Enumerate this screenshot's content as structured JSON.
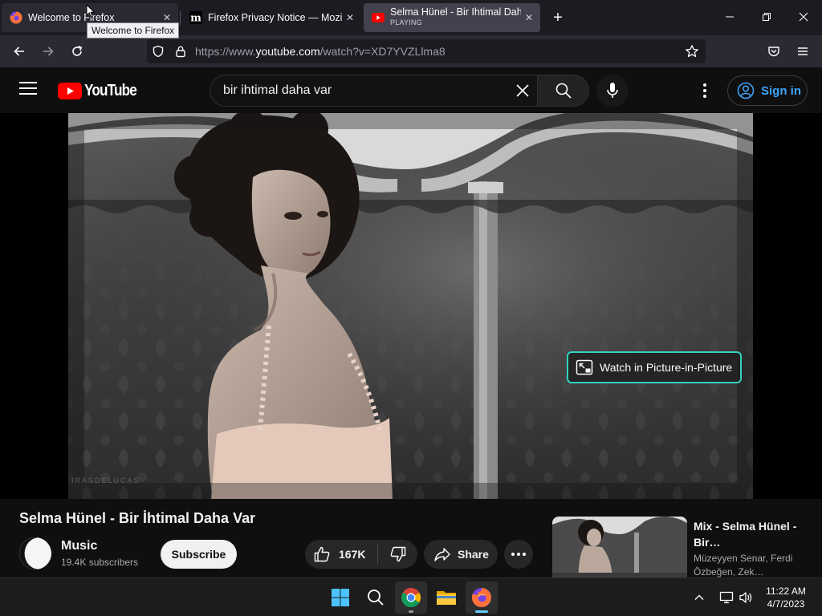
{
  "browser": {
    "tabs": [
      {
        "label": "Welcome to Firefox",
        "icon": "firefox-icon"
      },
      {
        "label": "Firefox Privacy Notice — Mozilla",
        "icon": "mozilla-m-icon"
      },
      {
        "label": "Selma Hünel - Bir İhtimal Daha Var",
        "sublabel": "PLAYING",
        "icon": "youtube-icon"
      }
    ],
    "tooltip": "Welcome to Firefox",
    "url": {
      "prefix": "https://www.",
      "domain": "youtube.com",
      "path": "/watch?v=XD7YVZLlma8"
    }
  },
  "youtube": {
    "logo_text": "YouTube",
    "search_value": "bir ihtimal daha var",
    "sign_in_label": "Sign in",
    "accent": "#3ea6ff",
    "brand_red": "#ff0000"
  },
  "player": {
    "pip_label": "Watch in Picture-in-Picture",
    "watermark": "IRASDELUCAS",
    "pip_border_color": "#33d2c0"
  },
  "video": {
    "title": "Selma Hünel - Bir İhtimal Daha Var",
    "channel_name": "Music",
    "subscribers": "19.4K subscribers",
    "subscribe_label": "Subscribe",
    "likes": "167K",
    "share_label": "Share"
  },
  "recommendation": {
    "title": "Mix - Selma Hünel - Bir İhtimal Daha Var",
    "title_display": "Mix - Selma Hünel - Bir…",
    "subtitle": "Müzeyyen Senar, Ferdi Özbeğen, Zek…"
  },
  "taskbar": {
    "time": "11:22 AM",
    "date": "4/7/2023"
  }
}
